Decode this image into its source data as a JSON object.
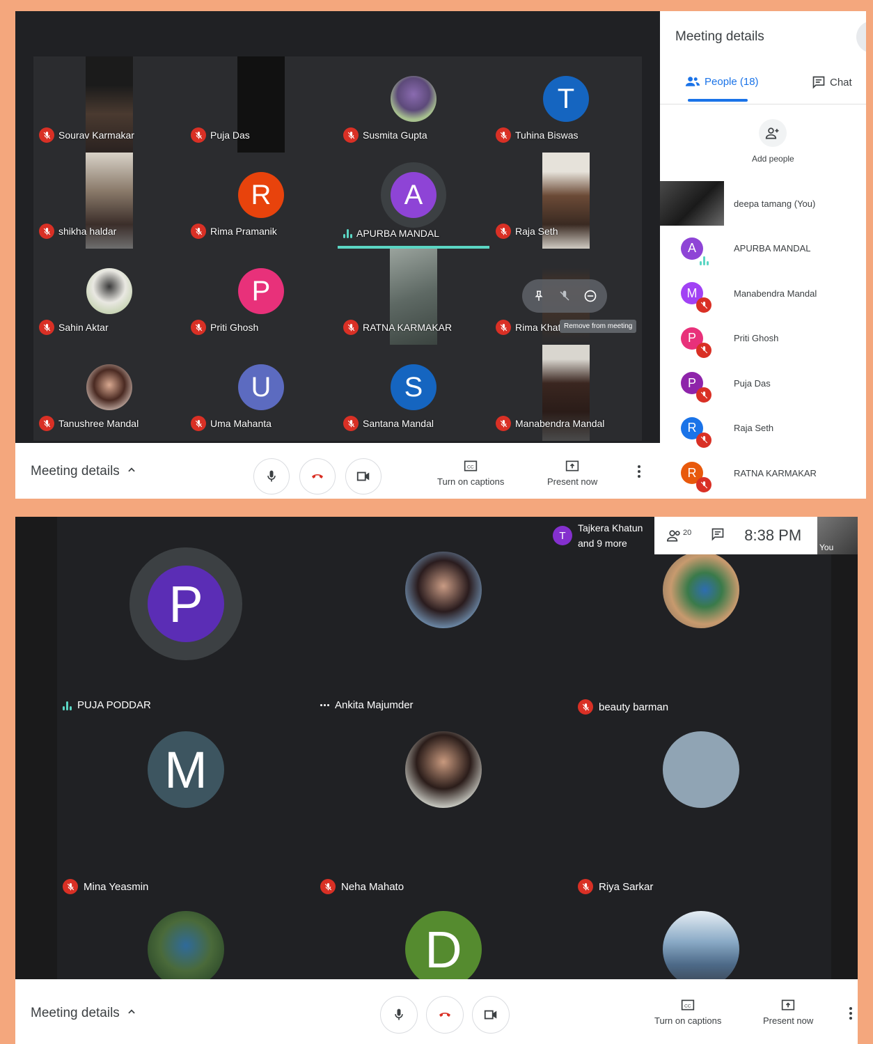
{
  "colors": {
    "page_background": "#f4a77d",
    "meet_dark": "#202124",
    "tile": "#2b2c2f",
    "muted_red": "#d93025",
    "active_teal": "#5bd6c4",
    "panel_blue": "#1a73e8"
  },
  "screenshot1": {
    "tiles": [
      {
        "name": "Sourav Karmakar",
        "mic": "muted",
        "media": "video"
      },
      {
        "name": "Puja Das",
        "mic": "muted",
        "media": "video"
      },
      {
        "name": "Susmita Gupta",
        "mic": "muted",
        "media": "photo"
      },
      {
        "name": "Tuhina Biswas",
        "mic": "muted",
        "media": "initial",
        "initial": "T",
        "color": "#1565c0"
      },
      {
        "name": "shikha haldar",
        "mic": "muted",
        "media": "video"
      },
      {
        "name": "Rima Pramanik",
        "mic": "muted",
        "media": "initial",
        "initial": "R",
        "color": "#e8430c"
      },
      {
        "name": "APURBA MANDAL",
        "mic": "speaking",
        "media": "initial",
        "initial": "A",
        "color": "#8e44d6"
      },
      {
        "name": "Raja Seth",
        "mic": "muted",
        "media": "video"
      },
      {
        "name": "Sahin Aktar",
        "mic": "muted",
        "media": "photo"
      },
      {
        "name": "Priti Ghosh",
        "mic": "muted",
        "media": "initial",
        "initial": "P",
        "color": "#e8317a"
      },
      {
        "name": "RATNA KARMAKAR",
        "mic": "muted",
        "media": "video"
      },
      {
        "name": "Rima Khat",
        "mic": "muted",
        "media": "video"
      },
      {
        "name": "Tanushree Mandal",
        "mic": "muted",
        "media": "photo"
      },
      {
        "name": "Uma Mahanta",
        "mic": "muted",
        "media": "initial",
        "initial": "U",
        "color": "#5c6bc0"
      },
      {
        "name": "Santana Mandal",
        "mic": "muted",
        "media": "initial",
        "initial": "S",
        "color": "#1565c0"
      },
      {
        "name": "Manabendra Mandal",
        "mic": "muted",
        "media": "video"
      }
    ],
    "hover_tooltip": "Remove from meeting",
    "bottom_bar": {
      "meeting_details": "Meeting details",
      "captions": "Turn on captions",
      "present": "Present now"
    },
    "panel": {
      "title": "Meeting details",
      "people_tab": "People (18)",
      "chat_tab": "Chat",
      "add_people": "Add people",
      "people": [
        {
          "name": "deepa tamang (You)",
          "type": "self"
        },
        {
          "name": "APURBA MANDAL",
          "initial": "A",
          "color": "#8e44d6",
          "status": "speaking"
        },
        {
          "name": "Manabendra Mandal",
          "initial": "M",
          "color": "#a142f4",
          "status": "muted"
        },
        {
          "name": "Priti Ghosh",
          "initial": "P",
          "color": "#e8317a",
          "status": "muted"
        },
        {
          "name": "Puja Das",
          "initial": "P",
          "color": "#8e24aa",
          "status": "muted"
        },
        {
          "name": "Raja Seth",
          "initial": "R",
          "color": "#1a73e8",
          "status": "muted"
        },
        {
          "name": "RATNA KARMAKAR",
          "initial": "R",
          "color": "#e8590c",
          "status": "muted"
        }
      ]
    }
  },
  "screenshot2": {
    "top": {
      "presenter_initial": "T",
      "presenter_line1": "Tajkera Khatun",
      "presenter_line2": "and 9 more",
      "people_count": "20",
      "time": "8:38 PM",
      "self_label": "You"
    },
    "tiles": [
      {
        "name": "PUJA PODDAR",
        "mic": "speaking",
        "media": "initial",
        "initial": "P",
        "color": "#5b2db5"
      },
      {
        "name": "Ankita Majumder",
        "mic": "dots",
        "media": "photo"
      },
      {
        "name": "beauty barman",
        "mic": "muted",
        "media": "photo"
      },
      {
        "name": "Mina Yeasmin",
        "mic": "muted",
        "media": "initial",
        "initial": "M",
        "color": "#3d5560"
      },
      {
        "name": "Neha Mahato",
        "mic": "muted",
        "media": "photo"
      },
      {
        "name": "Riya Sarkar",
        "mic": "muted",
        "media": "photo"
      },
      {
        "name": "",
        "mic": "none",
        "media": "photo"
      },
      {
        "name": "",
        "mic": "none",
        "media": "initial",
        "initial": "D",
        "color": "#558b2f"
      },
      {
        "name": "",
        "mic": "none",
        "media": "photo"
      }
    ],
    "bottom_bar": {
      "meeting_details": "Meeting details",
      "captions": "Turn on captions",
      "present": "Present now"
    }
  }
}
